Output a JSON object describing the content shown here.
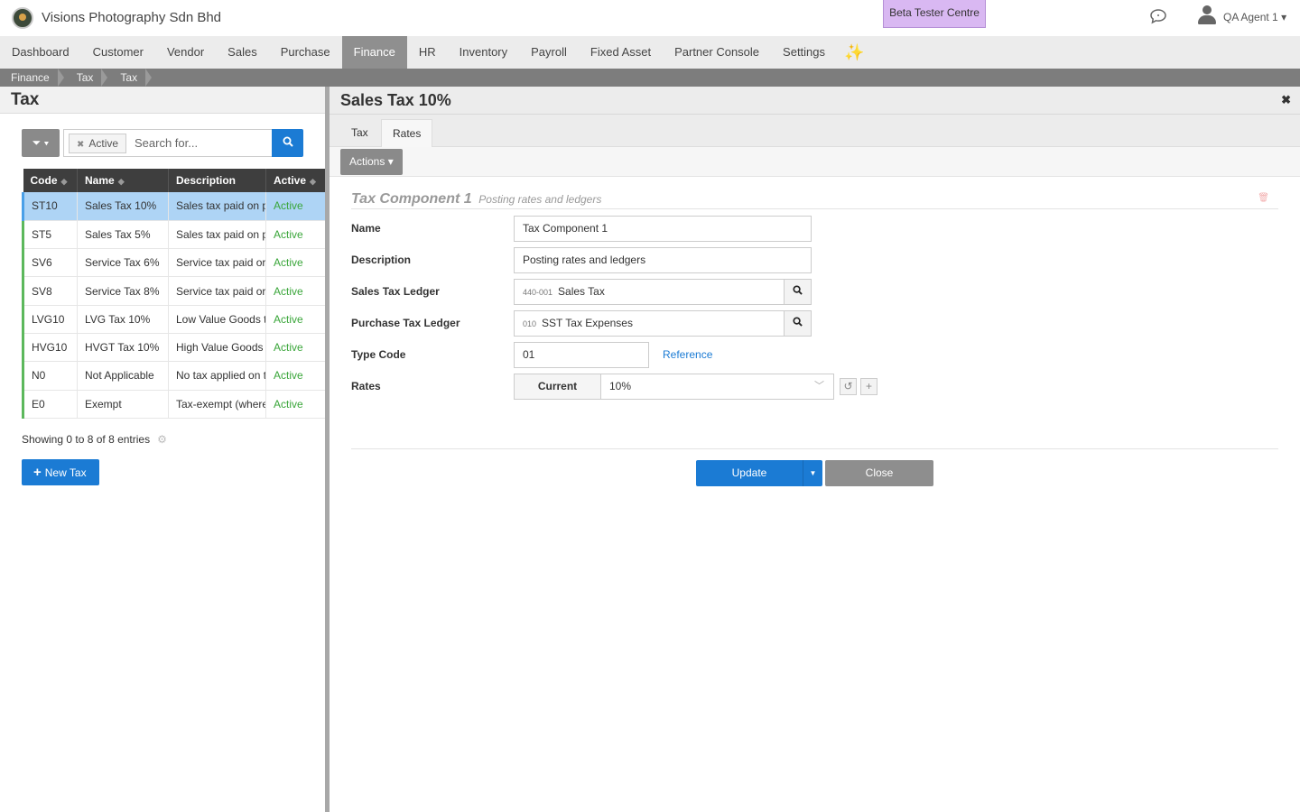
{
  "header": {
    "company": "Visions Photography Sdn Bhd",
    "beta_label": "Beta Tester Centre",
    "user": "QA Agent 1"
  },
  "nav": {
    "items": [
      "Dashboard",
      "Customer",
      "Vendor",
      "Sales",
      "Purchase",
      "Finance",
      "HR",
      "Inventory",
      "Payroll",
      "Fixed Asset",
      "Partner Console",
      "Settings"
    ],
    "active": "Finance"
  },
  "breadcrumb": [
    "Finance",
    "Tax",
    "Tax"
  ],
  "left": {
    "title": "Tax",
    "filter_tag": "Active",
    "search_placeholder": "Search for...",
    "columns": [
      "Code",
      "Name",
      "Description",
      "Active"
    ],
    "rows": [
      {
        "code": "ST10",
        "name": "Sales Tax 10%",
        "description": "Sales tax paid on p",
        "active": "Active"
      },
      {
        "code": "ST5",
        "name": "Sales Tax 5%",
        "description": "Sales tax paid on p",
        "active": "Active"
      },
      {
        "code": "SV6",
        "name": "Service Tax 6%",
        "description": "Service tax paid or",
        "active": "Active"
      },
      {
        "code": "SV8",
        "name": "Service Tax 8%",
        "description": "Service tax paid or",
        "active": "Active"
      },
      {
        "code": "LVG10",
        "name": "LVG Tax 10%",
        "description": "Low Value Goods t",
        "active": "Active"
      },
      {
        "code": "HVG10",
        "name": "HVGT Tax 10%",
        "description": "High Value Goods",
        "active": "Active"
      },
      {
        "code": "N0",
        "name": "Not Applicable",
        "description": "No tax applied on t",
        "active": "Active"
      },
      {
        "code": "E0",
        "name": "Exempt",
        "description": "Tax-exempt (where",
        "active": "Active"
      }
    ],
    "showing": "Showing 0 to 8 of 8 entries",
    "new_button": "New Tax"
  },
  "right": {
    "title": "Sales Tax 10%",
    "tabs": [
      "Tax",
      "Rates"
    ],
    "active_tab": "Rates",
    "actions_label": "Actions",
    "section_title": "Tax Component 1",
    "section_subtitle": "Posting rates and ledgers",
    "fields": {
      "name_label": "Name",
      "name_value": "Tax Component 1",
      "description_label": "Description",
      "description_value": "Posting rates and ledgers",
      "sales_ledger_label": "Sales Tax Ledger",
      "sales_ledger_code": "440-001",
      "sales_ledger_value": "Sales Tax",
      "purchase_ledger_label": "Purchase Tax Ledger",
      "purchase_ledger_code": "010",
      "purchase_ledger_value": "SST Tax Expenses",
      "type_code_label": "Type Code",
      "type_code_value": "01",
      "reference_link": "Reference",
      "rates_label": "Rates",
      "rates_period": "Current",
      "rates_value": "10%"
    },
    "update_label": "Update",
    "close_label": "Close"
  },
  "colors": {
    "primary": "#1b7bd4",
    "active_text": "#3aa63a",
    "selected_row": "#aed4f5",
    "nav_active": "#8f8f8f"
  }
}
